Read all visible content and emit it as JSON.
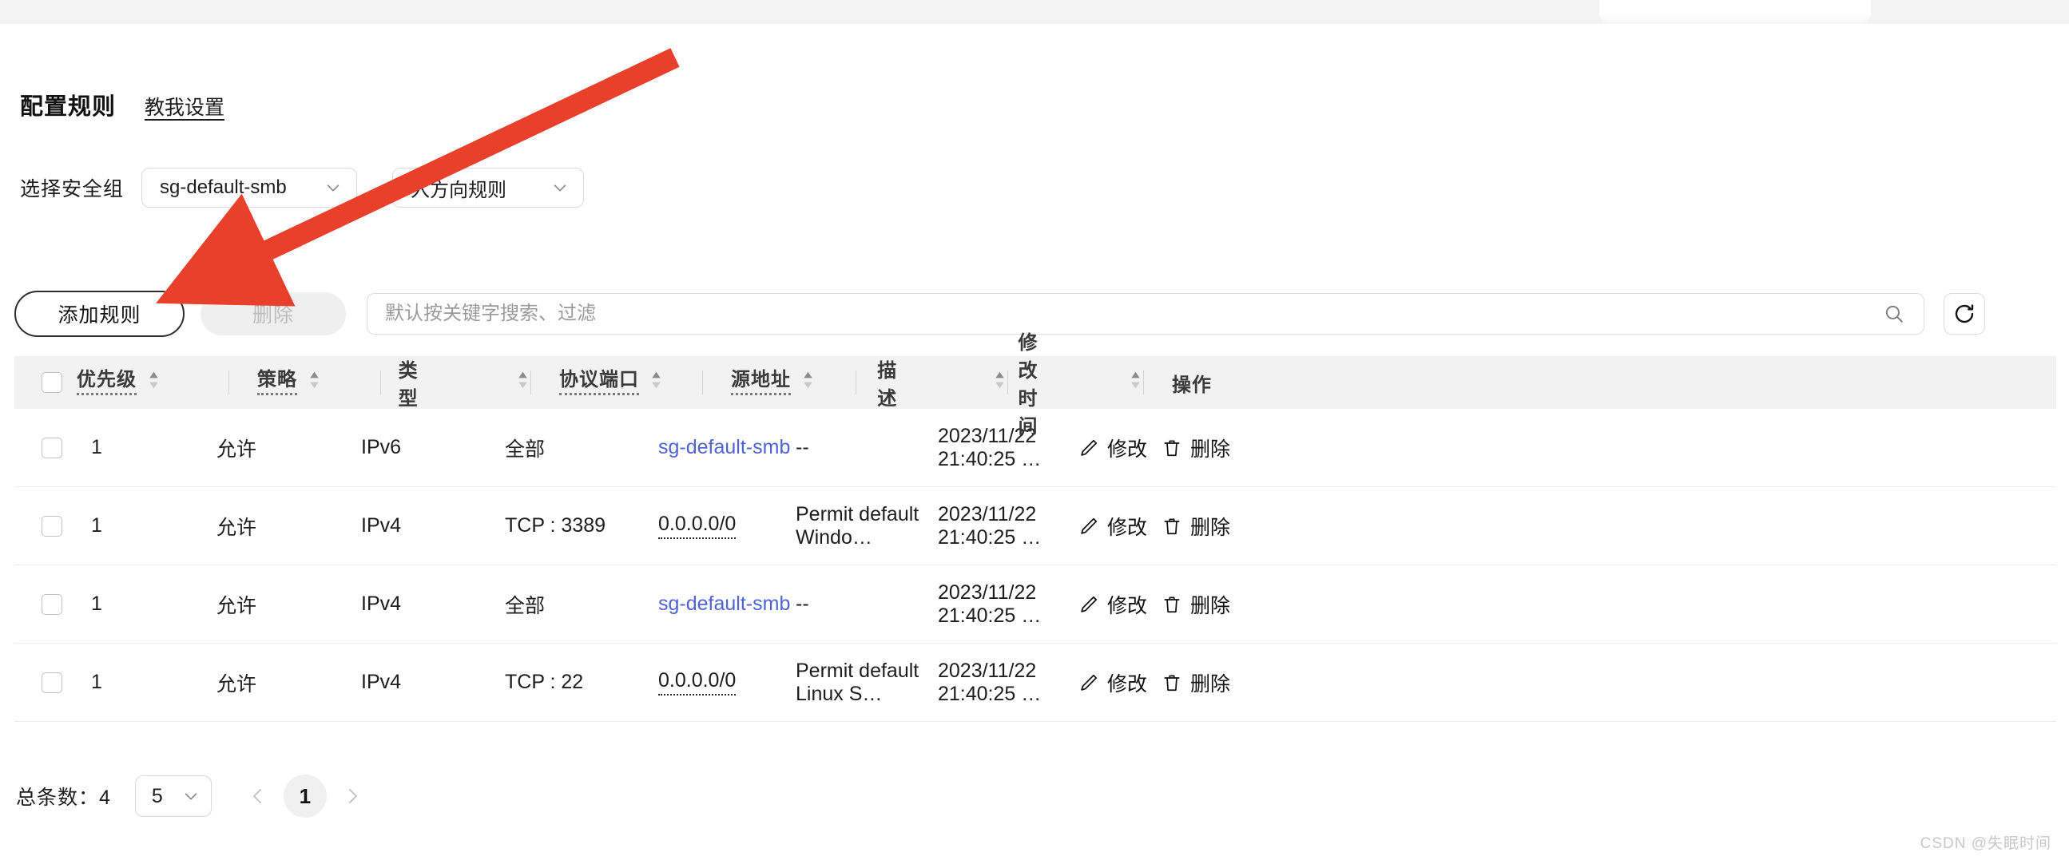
{
  "page": {
    "title": "配置规则",
    "help_link": "教我设置"
  },
  "filters": {
    "label": "选择安全组",
    "security_group": {
      "value": "sg-default-smb",
      "icon": "chevron-down-icon"
    },
    "direction": {
      "value": "入方向规则",
      "icon": "chevron-down-icon"
    }
  },
  "toolbar": {
    "add_label": "添加规则",
    "delete_label": "删除",
    "search_placeholder": "默认按关键字搜索、过滤",
    "search_value": "",
    "search_icon": "search-icon",
    "refresh_icon": "refresh-icon"
  },
  "table": {
    "columns": [
      {
        "label": "优先级",
        "sortable": true,
        "dotted": true
      },
      {
        "label": "策略",
        "sortable": true,
        "dotted": true
      },
      {
        "label": "类型",
        "sortable": true,
        "dotted": false
      },
      {
        "label": "协议端口",
        "sortable": true,
        "dotted": true
      },
      {
        "label": "源地址",
        "sortable": true,
        "dotted": true
      },
      {
        "label": "描述",
        "sortable": true,
        "dotted": false
      },
      {
        "label": "修改时间",
        "sortable": true,
        "dotted": false
      },
      {
        "label": "操作",
        "sortable": false,
        "dotted": false
      }
    ],
    "sort_icon": "sort-arrows-icon",
    "select_all_checked": false,
    "rows": [
      {
        "priority": "1",
        "policy": "允许",
        "type": "IPv6",
        "port": "全部",
        "source": "sg-default-smb",
        "source_style": "link",
        "description": "--",
        "modified": "2023/11/22 21:40:25 …",
        "edit_label": "修改",
        "delete_label": "删除"
      },
      {
        "priority": "1",
        "policy": "允许",
        "type": "IPv4",
        "port": "TCP : 3389",
        "source": "0.0.0.0/0",
        "source_style": "dotted",
        "description": "Permit default Windo…",
        "modified": "2023/11/22 21:40:25 …",
        "edit_label": "修改",
        "delete_label": "删除"
      },
      {
        "priority": "1",
        "policy": "允许",
        "type": "IPv4",
        "port": "全部",
        "source": "sg-default-smb",
        "source_style": "link",
        "description": "--",
        "modified": "2023/11/22 21:40:25 …",
        "edit_label": "修改",
        "delete_label": "删除"
      },
      {
        "priority": "1",
        "policy": "允许",
        "type": "IPv4",
        "port": "TCP : 22",
        "source": "0.0.0.0/0",
        "source_style": "dotted",
        "description": "Permit default Linux S…",
        "modified": "2023/11/22 21:40:25 …",
        "edit_label": "修改",
        "delete_label": "删除"
      }
    ]
  },
  "footer": {
    "total": "总条数：4",
    "page_size": "5",
    "current_page": "1",
    "prev_icon": "chevron-left-icon",
    "next_icon": "chevron-right-icon"
  },
  "watermark": "CSDN @失眠时间",
  "colors": {
    "link": "#4f62d6",
    "annotation_arrow": "#e8402a",
    "header_bg": "#f2f2f2",
    "disabled_bg": "#efefef"
  }
}
